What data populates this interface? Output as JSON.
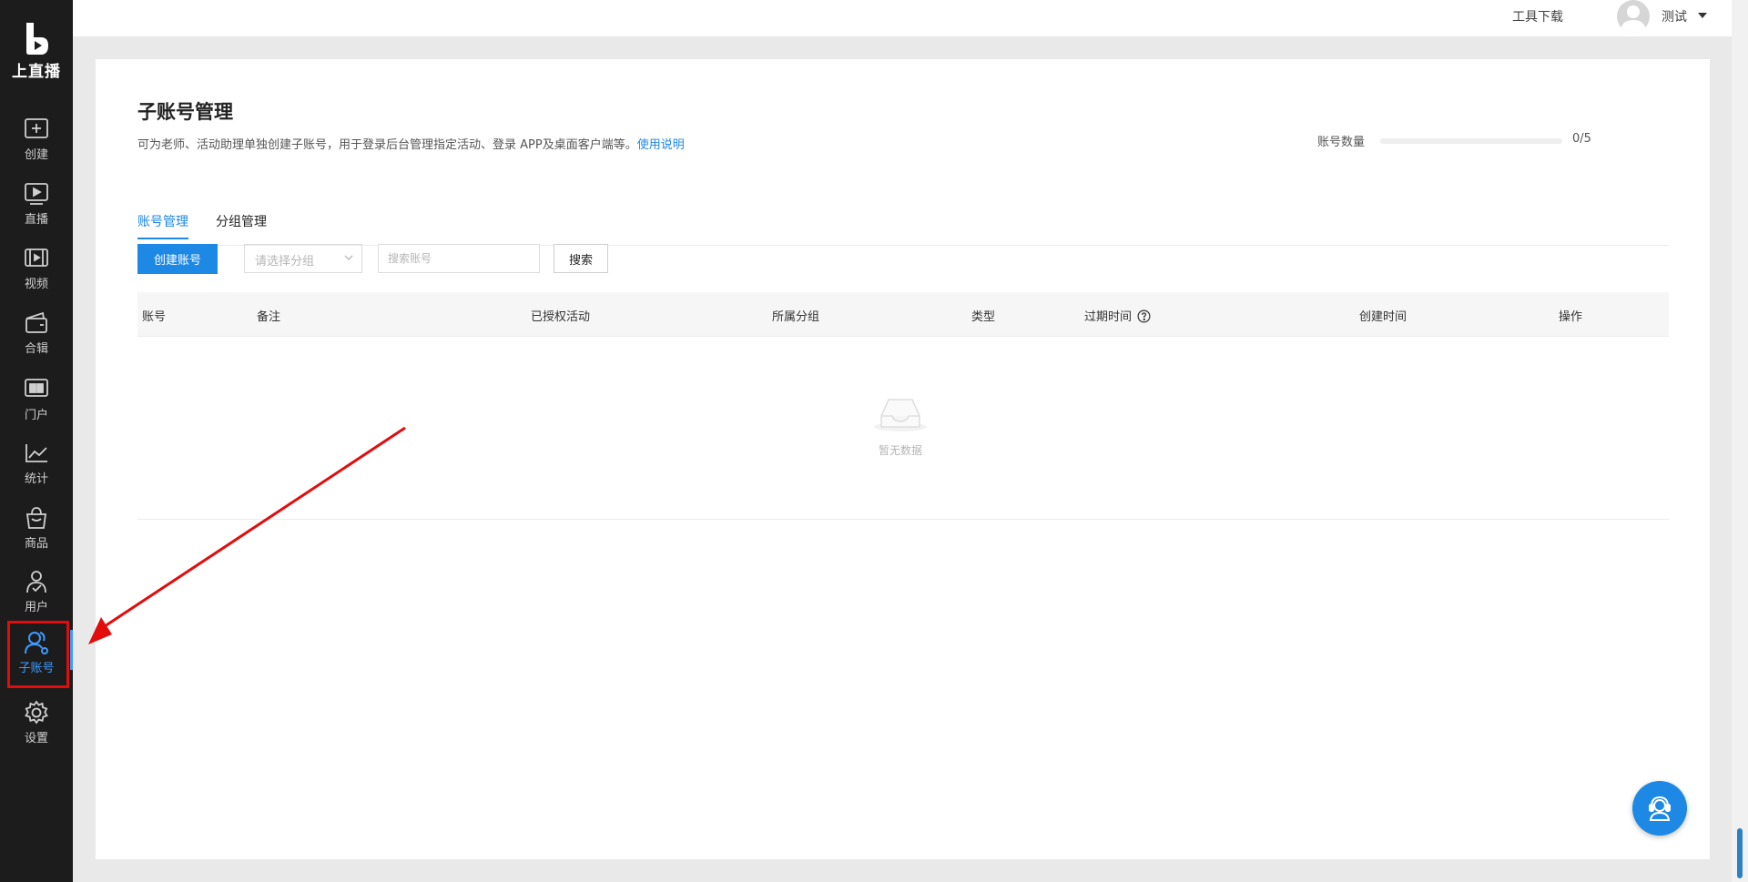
{
  "brand": {
    "name": "上直播"
  },
  "sidebar": {
    "items": [
      {
        "label": "创建",
        "icon": "plus-square-icon"
      },
      {
        "label": "直播",
        "icon": "play-screen-icon"
      },
      {
        "label": "视频",
        "icon": "film-icon"
      },
      {
        "label": "合辑",
        "icon": "wallet-icon"
      },
      {
        "label": "门户",
        "icon": "portal-grid-icon"
      },
      {
        "label": "统计",
        "icon": "line-chart-icon"
      },
      {
        "label": "商品",
        "icon": "shopping-bag-icon"
      },
      {
        "label": "用户",
        "icon": "user-check-icon"
      },
      {
        "label": "子账号",
        "icon": "sub-account-icon",
        "active": true
      },
      {
        "label": "设置",
        "icon": "gear-icon"
      }
    ],
    "active_color": "#3d9bff",
    "highlight_color": "#e20c0c"
  },
  "header": {
    "tools_link": "工具下载",
    "user_name": "测试"
  },
  "page": {
    "title": "子账号管理",
    "description": "可为老师、活动助理单独创建子账号，用于登录后台管理指定活动、登录 APP及桌面客户端等。",
    "help_link": "使用说明",
    "quota": {
      "label": "账号数量",
      "value": "0/5",
      "used": 0,
      "total": 5
    }
  },
  "tabs": [
    {
      "label": "账号管理",
      "active": true
    },
    {
      "label": "分组管理",
      "active": false
    }
  ],
  "toolbar": {
    "create_label": "创建账号",
    "group_select_placeholder": "请选择分组",
    "search_placeholder": "搜索账号",
    "search_button": "搜索"
  },
  "table": {
    "columns": [
      "账号",
      "备注",
      "已授权活动",
      "所属分组",
      "类型",
      "过期时间",
      "创建时间",
      "操作"
    ],
    "empty_text": "暂无数据"
  },
  "colors": {
    "primary": "#1e88e5",
    "sidebar_bg": "#1c1c1c",
    "annotation_red": "#e20c0c"
  }
}
